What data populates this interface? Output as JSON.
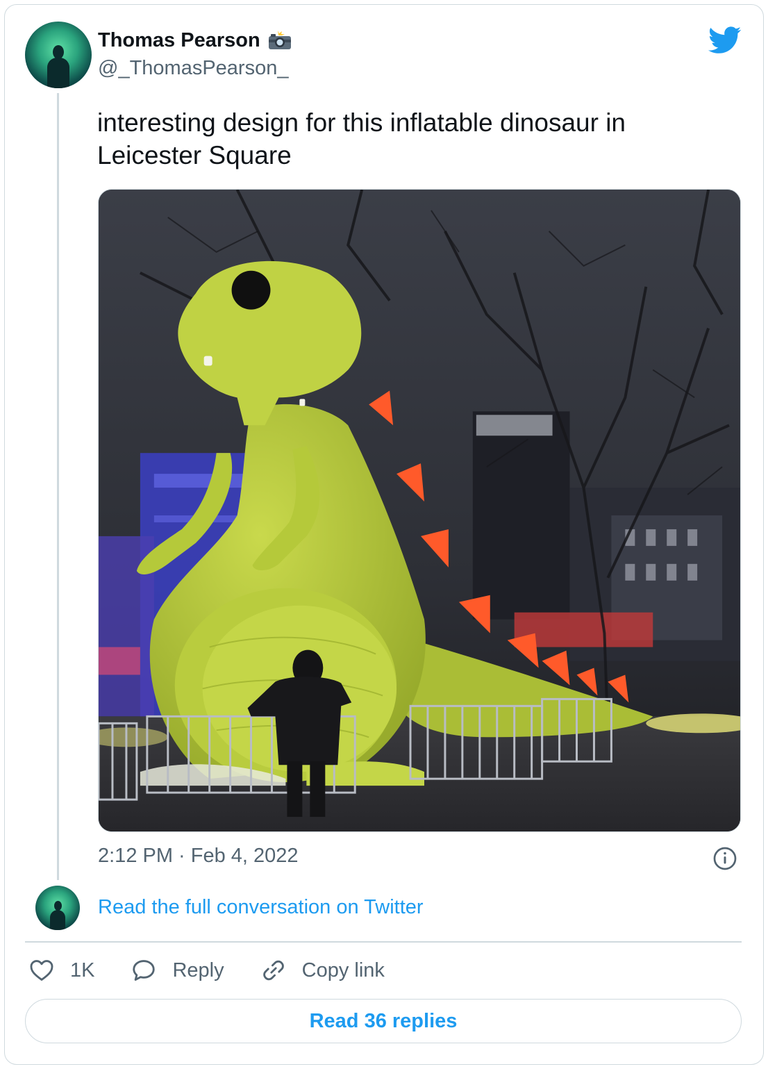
{
  "tweet": {
    "display_name": "Thomas Pearson",
    "display_name_emoji_icon": "camera-with-flash-icon",
    "handle": "@_ThomasPearson_",
    "text": "interesting design for this inflatable dinosaur in Leicester Square",
    "timestamp": "2:12 PM · Feb 4, 2022"
  },
  "thread": {
    "read_full_label": "Read the full conversation on Twitter"
  },
  "actions": {
    "like_count": "1K",
    "reply_label": "Reply",
    "copy_link_label": "Copy link"
  },
  "footer": {
    "read_replies_label": "Read 36 replies"
  },
  "colors": {
    "twitter_blue": "#1d9bf0",
    "secondary_text": "#536471",
    "border": "#cfd9de",
    "dinosaur_green": "#b5c93a",
    "dinosaur_spikes": "#ff5a2a"
  },
  "icons": [
    "twitter-bird-icon",
    "info-icon",
    "heart-icon",
    "reply-bubble-icon",
    "link-icon"
  ]
}
